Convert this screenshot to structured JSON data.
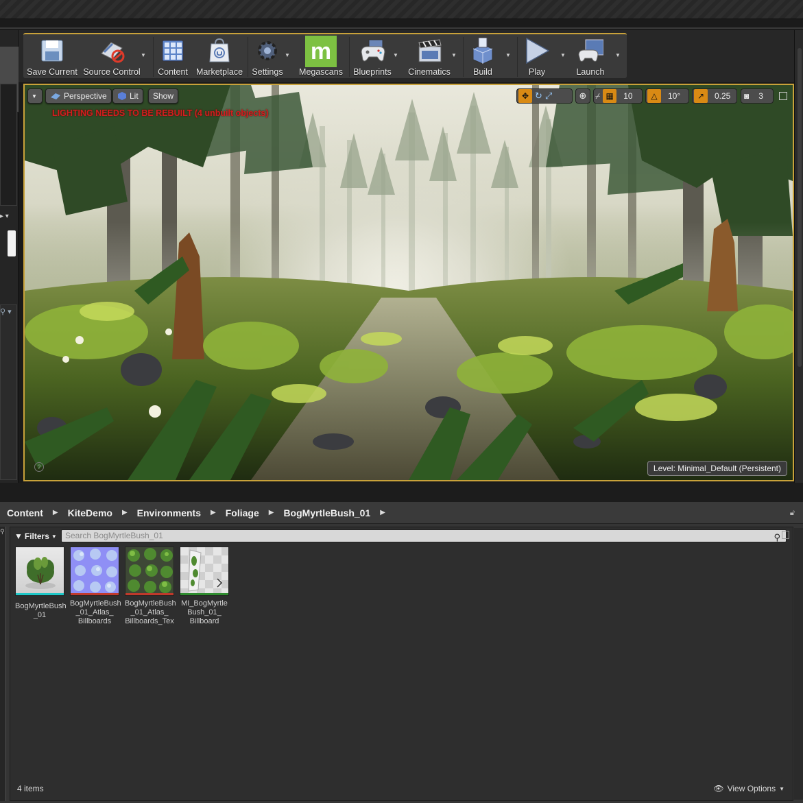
{
  "toolbar": {
    "save_current": "Save Current",
    "source_control": "Source Control",
    "content": "Content",
    "marketplace": "Marketplace",
    "settings": "Settings",
    "megascans": "Megascans",
    "blueprints": "Blueprints",
    "cinematics": "Cinematics",
    "build": "Build",
    "play": "Play",
    "launch": "Launch"
  },
  "viewport": {
    "perspective": "Perspective",
    "lit": "Lit",
    "show": "Show",
    "warning": "LIGHTING NEEDS TO BE REBUILT (4 unbuilt objects)",
    "grid_snap": "10",
    "rotation_snap": "10°",
    "scale_snap": "0.25",
    "camera_speed": "3",
    "level_prefix": "Level:",
    "level_name": "Minimal_Default (Persistent)"
  },
  "content_browser": {
    "breadcrumb": [
      "Content",
      "KiteDemo",
      "Environments",
      "Foliage",
      "BogMyrtleBush_01"
    ],
    "filters": "Filters",
    "search_placeholder": "Search BogMyrtleBush_01",
    "assets": [
      {
        "name": "BogMyrtleBush_01",
        "bar_color": "#1ec8c8",
        "icon": "static-mesh-icon"
      },
      {
        "name": "BogMyrtleBush_01_Atlas_Billboards",
        "bar_color": "#c0392b",
        "icon": "normal-map-texture-icon"
      },
      {
        "name": "BogMyrtleBush_01_Atlas_Billboards_Tex",
        "bar_color": "#c0392b",
        "icon": "texture-icon"
      },
      {
        "name": "MI_BogMyrtleBush_01_Billboard",
        "bar_color": "#2e8b2e",
        "icon": "material-instance-icon"
      }
    ],
    "asset_labels": [
      [
        "BogMyrtleBush",
        "_01"
      ],
      [
        "BogMyrtleBush",
        "_01_Atlas_",
        "Billboards"
      ],
      [
        "BogMyrtleBush",
        "_01_Atlas_",
        "Billboards_Tex"
      ],
      [
        "MI_BogMyrtle",
        "Bush_01_",
        "Billboard"
      ]
    ],
    "item_count": "4 items",
    "view_options": "View Options"
  },
  "colors": {
    "accent": "#c9a23a",
    "megascans_green": "#7dc142",
    "warning_red": "#d21e1e",
    "snap_orange": "#d98a14"
  }
}
